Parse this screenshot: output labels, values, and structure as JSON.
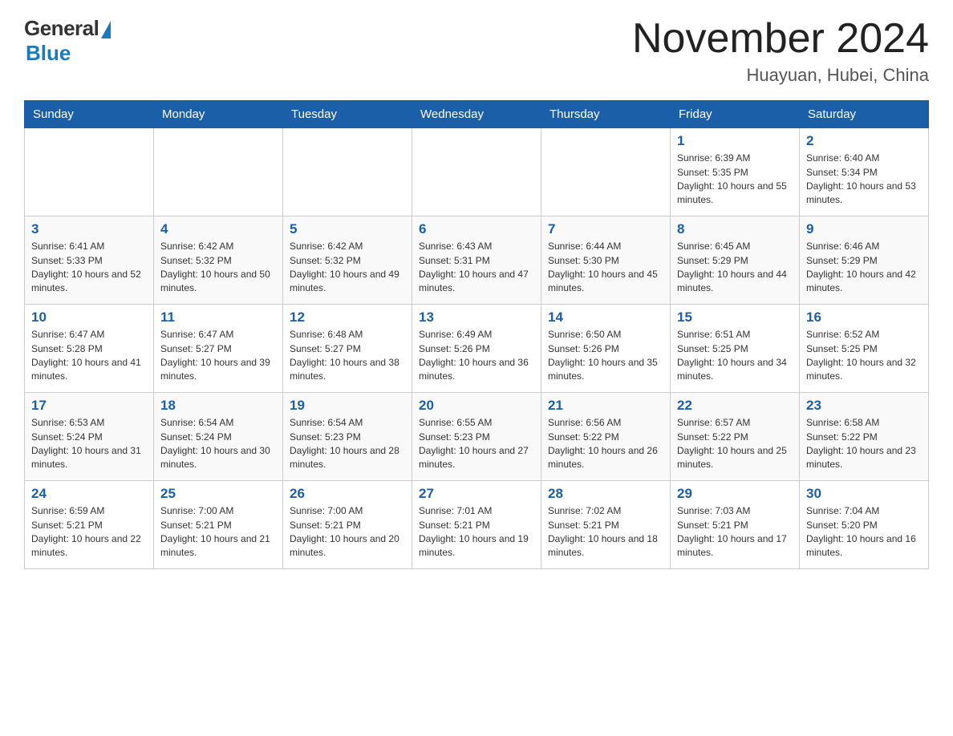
{
  "logo": {
    "general": "General",
    "blue": "Blue",
    "subtitle": "Blue"
  },
  "header": {
    "month": "November 2024",
    "location": "Huayuan, Hubei, China"
  },
  "weekdays": [
    "Sunday",
    "Monday",
    "Tuesday",
    "Wednesday",
    "Thursday",
    "Friday",
    "Saturday"
  ],
  "weeks": [
    [
      {
        "day": "",
        "info": ""
      },
      {
        "day": "",
        "info": ""
      },
      {
        "day": "",
        "info": ""
      },
      {
        "day": "",
        "info": ""
      },
      {
        "day": "",
        "info": ""
      },
      {
        "day": "1",
        "info": "Sunrise: 6:39 AM\nSunset: 5:35 PM\nDaylight: 10 hours and 55 minutes."
      },
      {
        "day": "2",
        "info": "Sunrise: 6:40 AM\nSunset: 5:34 PM\nDaylight: 10 hours and 53 minutes."
      }
    ],
    [
      {
        "day": "3",
        "info": "Sunrise: 6:41 AM\nSunset: 5:33 PM\nDaylight: 10 hours and 52 minutes."
      },
      {
        "day": "4",
        "info": "Sunrise: 6:42 AM\nSunset: 5:32 PM\nDaylight: 10 hours and 50 minutes."
      },
      {
        "day": "5",
        "info": "Sunrise: 6:42 AM\nSunset: 5:32 PM\nDaylight: 10 hours and 49 minutes."
      },
      {
        "day": "6",
        "info": "Sunrise: 6:43 AM\nSunset: 5:31 PM\nDaylight: 10 hours and 47 minutes."
      },
      {
        "day": "7",
        "info": "Sunrise: 6:44 AM\nSunset: 5:30 PM\nDaylight: 10 hours and 45 minutes."
      },
      {
        "day": "8",
        "info": "Sunrise: 6:45 AM\nSunset: 5:29 PM\nDaylight: 10 hours and 44 minutes."
      },
      {
        "day": "9",
        "info": "Sunrise: 6:46 AM\nSunset: 5:29 PM\nDaylight: 10 hours and 42 minutes."
      }
    ],
    [
      {
        "day": "10",
        "info": "Sunrise: 6:47 AM\nSunset: 5:28 PM\nDaylight: 10 hours and 41 minutes."
      },
      {
        "day": "11",
        "info": "Sunrise: 6:47 AM\nSunset: 5:27 PM\nDaylight: 10 hours and 39 minutes."
      },
      {
        "day": "12",
        "info": "Sunrise: 6:48 AM\nSunset: 5:27 PM\nDaylight: 10 hours and 38 minutes."
      },
      {
        "day": "13",
        "info": "Sunrise: 6:49 AM\nSunset: 5:26 PM\nDaylight: 10 hours and 36 minutes."
      },
      {
        "day": "14",
        "info": "Sunrise: 6:50 AM\nSunset: 5:26 PM\nDaylight: 10 hours and 35 minutes."
      },
      {
        "day": "15",
        "info": "Sunrise: 6:51 AM\nSunset: 5:25 PM\nDaylight: 10 hours and 34 minutes."
      },
      {
        "day": "16",
        "info": "Sunrise: 6:52 AM\nSunset: 5:25 PM\nDaylight: 10 hours and 32 minutes."
      }
    ],
    [
      {
        "day": "17",
        "info": "Sunrise: 6:53 AM\nSunset: 5:24 PM\nDaylight: 10 hours and 31 minutes."
      },
      {
        "day": "18",
        "info": "Sunrise: 6:54 AM\nSunset: 5:24 PM\nDaylight: 10 hours and 30 minutes."
      },
      {
        "day": "19",
        "info": "Sunrise: 6:54 AM\nSunset: 5:23 PM\nDaylight: 10 hours and 28 minutes."
      },
      {
        "day": "20",
        "info": "Sunrise: 6:55 AM\nSunset: 5:23 PM\nDaylight: 10 hours and 27 minutes."
      },
      {
        "day": "21",
        "info": "Sunrise: 6:56 AM\nSunset: 5:22 PM\nDaylight: 10 hours and 26 minutes."
      },
      {
        "day": "22",
        "info": "Sunrise: 6:57 AM\nSunset: 5:22 PM\nDaylight: 10 hours and 25 minutes."
      },
      {
        "day": "23",
        "info": "Sunrise: 6:58 AM\nSunset: 5:22 PM\nDaylight: 10 hours and 23 minutes."
      }
    ],
    [
      {
        "day": "24",
        "info": "Sunrise: 6:59 AM\nSunset: 5:21 PM\nDaylight: 10 hours and 22 minutes."
      },
      {
        "day": "25",
        "info": "Sunrise: 7:00 AM\nSunset: 5:21 PM\nDaylight: 10 hours and 21 minutes."
      },
      {
        "day": "26",
        "info": "Sunrise: 7:00 AM\nSunset: 5:21 PM\nDaylight: 10 hours and 20 minutes."
      },
      {
        "day": "27",
        "info": "Sunrise: 7:01 AM\nSunset: 5:21 PM\nDaylight: 10 hours and 19 minutes."
      },
      {
        "day": "28",
        "info": "Sunrise: 7:02 AM\nSunset: 5:21 PM\nDaylight: 10 hours and 18 minutes."
      },
      {
        "day": "29",
        "info": "Sunrise: 7:03 AM\nSunset: 5:21 PM\nDaylight: 10 hours and 17 minutes."
      },
      {
        "day": "30",
        "info": "Sunrise: 7:04 AM\nSunset: 5:20 PM\nDaylight: 10 hours and 16 minutes."
      }
    ]
  ]
}
